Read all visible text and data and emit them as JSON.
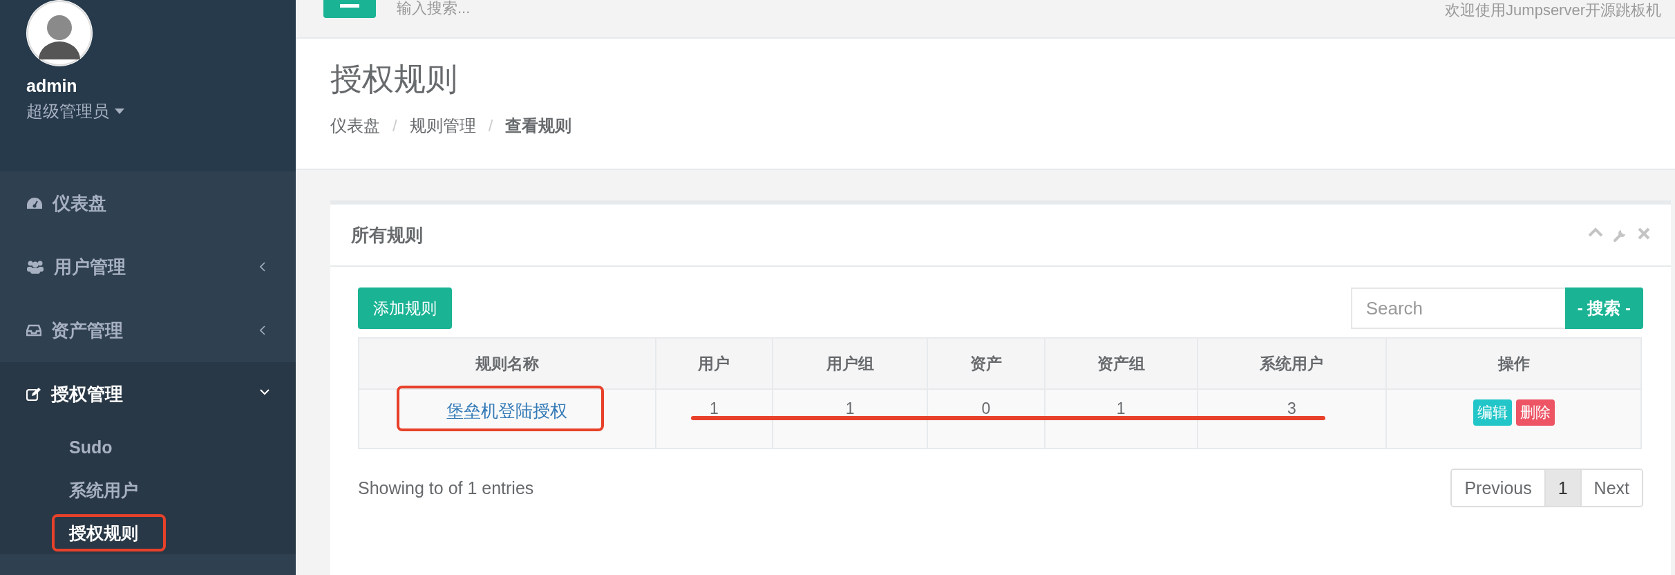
{
  "topbar": {
    "search_placeholder": "输入搜索...",
    "welcome": "欢迎使用Jumpserver开源跳板机"
  },
  "profile": {
    "name": "admin",
    "role": "超级管理员"
  },
  "sidebar": {
    "items": [
      {
        "label": "仪表盘",
        "kind": "link"
      },
      {
        "label": "用户管理",
        "kind": "group",
        "expanded": false
      },
      {
        "label": "资产管理",
        "kind": "group",
        "expanded": false
      },
      {
        "label": "授权管理",
        "kind": "group",
        "expanded": true,
        "children": [
          {
            "label": "Sudo",
            "selected": false,
            "highlighted": false
          },
          {
            "label": "系统用户",
            "selected": false,
            "highlighted": false
          },
          {
            "label": "授权规则",
            "selected": true,
            "highlighted": true
          }
        ]
      }
    ]
  },
  "page": {
    "title": "授权规则",
    "separator": "/",
    "breadcrumb": [
      {
        "label": "仪表盘",
        "current": false
      },
      {
        "label": "规则管理",
        "current": false
      },
      {
        "label": "查看规则",
        "current": true
      }
    ]
  },
  "card": {
    "title": "所有规则",
    "add_button": "添加规则",
    "search": {
      "placeholder": "Search",
      "button": "- 搜索 -"
    },
    "table": {
      "columns": [
        "规则名称",
        "用户",
        "用户组",
        "资产",
        "资产组",
        "系统用户",
        "操作"
      ],
      "rows": [
        {
          "cells": [
            "堡垒机登陆授权",
            "1",
            "1",
            "0",
            "1",
            "3"
          ],
          "actions": [
            {
              "label": "编辑",
              "kind": "edit"
            },
            {
              "label": "删除",
              "kind": "delete"
            }
          ],
          "name_highlighted": true,
          "struck": true
        }
      ]
    },
    "info": "Showing to of 1 entries",
    "pagination": [
      {
        "label": "Previous",
        "selected": false
      },
      {
        "label": "1",
        "selected": true
      },
      {
        "label": "Next",
        "selected": false
      }
    ]
  }
}
